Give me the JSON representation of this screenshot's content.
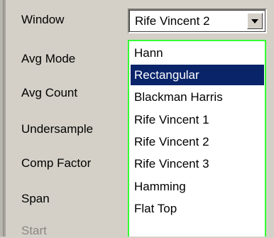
{
  "labels": {
    "window": "Window",
    "avg_mode": "Avg Mode",
    "avg_count": "Avg Count",
    "undersample": "Undersample",
    "comp_factor": "Comp Factor",
    "span": "Span",
    "start": "Start"
  },
  "window_select": {
    "value": "Rife Vincent 2",
    "selected_option": "Rectangular",
    "options": [
      "Hann",
      "Rectangular",
      "Blackman Harris",
      "Rife Vincent 1",
      "Rife Vincent 2",
      "Rife Vincent 3",
      "Hamming",
      "Flat Top"
    ]
  },
  "colors": {
    "panel": "#d4d0c8",
    "dropdown_border": "#33ff33",
    "selection": "#0a246a"
  }
}
